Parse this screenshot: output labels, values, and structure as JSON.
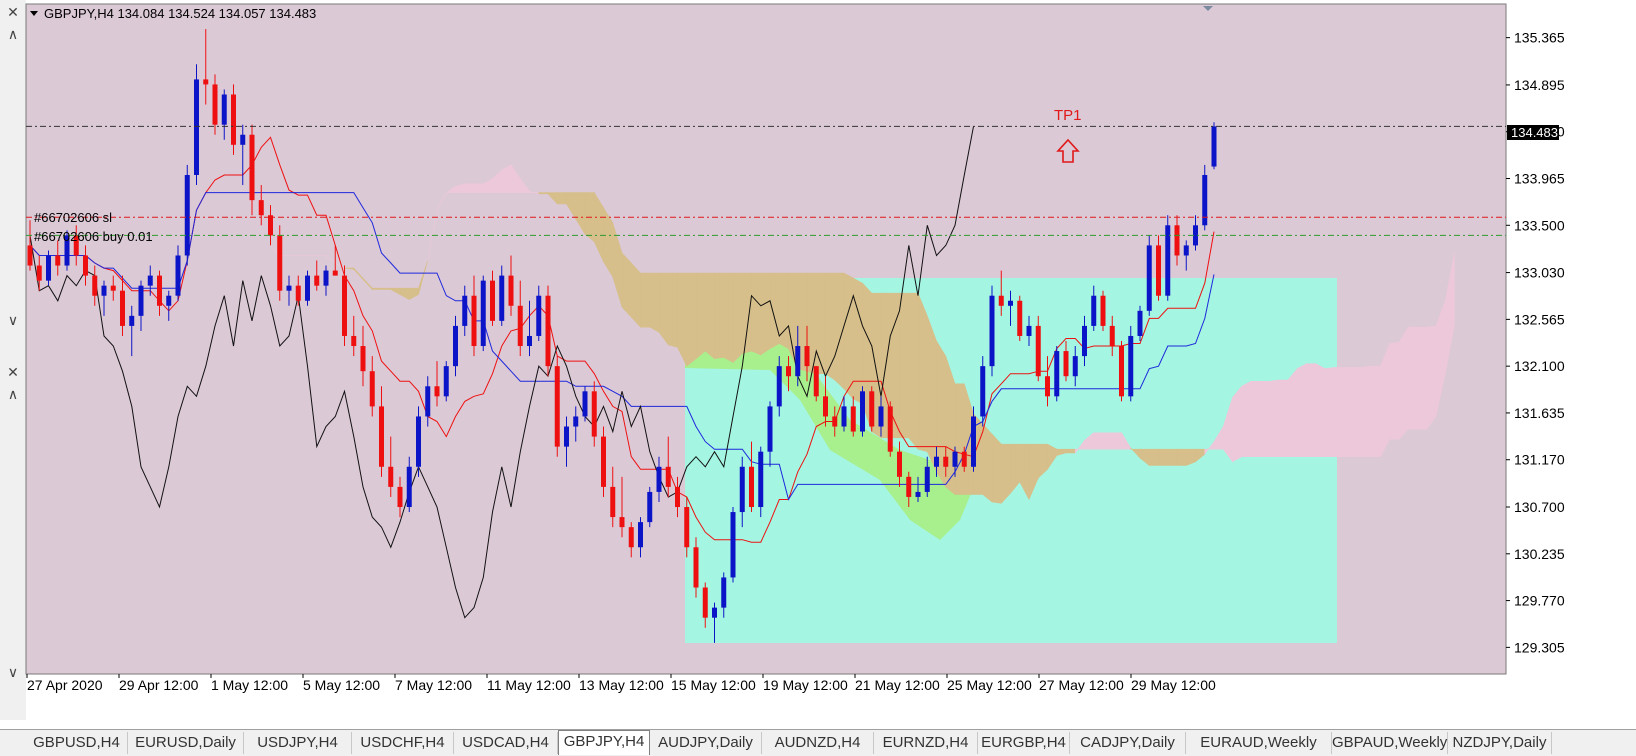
{
  "window": {
    "symbol_header": "GBPJPY,H4  134.084 134.524 134.057 134.483"
  },
  "colors": {
    "chart_bg": "#dcc9d6",
    "bull": "#0c14c8",
    "bear": "#ee1010",
    "tenkan": "#ee1010",
    "kijun": "#1e28dc",
    "chikou": "#111111",
    "kumo_bear": "#d6bf8a",
    "kumo_bull": "#ecc8da",
    "zone_cyan": "#a4f6e2",
    "zone_green": "#a8ee84"
  },
  "price_axis": {
    "ticks": [
      "135.365",
      "134.895",
      "134.430",
      "133.965",
      "133.500",
      "133.030",
      "132.565",
      "132.100",
      "131.635",
      "131.170",
      "130.700",
      "130.235",
      "129.770",
      "129.305"
    ],
    "current_price_label": "134.483"
  },
  "time_axis": {
    "labels": [
      "27 Apr 2020",
      "29 Apr 12:00",
      "1 May 12:00",
      "5 May 12:00",
      "7 May 12:00",
      "11 May 12:00",
      "13 May 12:00",
      "15 May 12:00",
      "19 May 12:00",
      "21 May 12:00",
      "25 May 12:00",
      "27 May 12:00",
      "29 May 12:00"
    ]
  },
  "annotations": {
    "tp_label": "TP1",
    "sl_label": "#66702606 sl",
    "buy_label": "#66702606 buy 0.01"
  },
  "tabs": [
    {
      "label": "GBPUSD,H4"
    },
    {
      "label": "EURUSD,Daily"
    },
    {
      "label": "USDJPY,H4"
    },
    {
      "label": "USDCHF,H4"
    },
    {
      "label": "USDCAD,H4"
    },
    {
      "label": "GBPJPY,H4"
    },
    {
      "label": "AUDJPY,Daily"
    },
    {
      "label": "AUDNZD,H4"
    },
    {
      "label": "EURNZD,H4"
    },
    {
      "label": "EURGBP,H4"
    },
    {
      "label": "CADJPY,Daily"
    },
    {
      "label": "EURAUD,Weekly"
    },
    {
      "label": "GBPAUD,Weekly"
    },
    {
      "label": "NZDJPY,Daily"
    }
  ],
  "chart_data": {
    "type": "candlestick",
    "title": "GBPJPY,H4  134.084 134.524 134.057 134.483",
    "ylim": [
      129.1,
      135.6
    ],
    "current_price": 134.483,
    "sl_price": 133.58,
    "buy_price": 133.4,
    "candles": [
      [
        133.3,
        133.55,
        133.05,
        133.1
      ],
      [
        133.1,
        133.2,
        132.85,
        132.95
      ],
      [
        132.95,
        133.25,
        132.9,
        133.2
      ],
      [
        133.2,
        133.35,
        133.0,
        133.1
      ],
      [
        133.1,
        133.45,
        133.05,
        133.4
      ],
      [
        133.4,
        133.5,
        133.1,
        133.2
      ],
      [
        133.2,
        133.3,
        132.9,
        133.0
      ],
      [
        133.0,
        133.1,
        132.7,
        132.8
      ],
      [
        132.8,
        132.95,
        132.6,
        132.9
      ],
      [
        132.9,
        133.0,
        132.75,
        132.85
      ],
      [
        132.85,
        133.0,
        132.4,
        132.5
      ],
      [
        132.5,
        132.7,
        132.2,
        132.6
      ],
      [
        132.6,
        132.95,
        132.45,
        132.9
      ],
      [
        132.9,
        133.1,
        132.8,
        133.0
      ],
      [
        133.0,
        133.05,
        132.6,
        132.7
      ],
      [
        132.7,
        132.85,
        132.55,
        132.8
      ],
      [
        132.8,
        133.3,
        132.75,
        133.2
      ],
      [
        133.2,
        134.1,
        133.1,
        134.0
      ],
      [
        134.0,
        135.1,
        133.9,
        134.95
      ],
      [
        134.95,
        135.45,
        134.7,
        134.9
      ],
      [
        134.9,
        135.0,
        134.4,
        134.5
      ],
      [
        134.5,
        134.85,
        134.35,
        134.8
      ],
      [
        134.8,
        134.9,
        134.2,
        134.3
      ],
      [
        134.3,
        134.5,
        133.9,
        134.4
      ],
      [
        134.4,
        134.5,
        133.6,
        133.75
      ],
      [
        133.75,
        133.9,
        133.5,
        133.6
      ],
      [
        133.6,
        133.7,
        133.3,
        133.4
      ],
      [
        133.4,
        133.5,
        132.75,
        132.85
      ],
      [
        132.85,
        133.0,
        132.7,
        132.9
      ],
      [
        132.9,
        133.0,
        132.7,
        132.75
      ],
      [
        132.75,
        133.05,
        132.7,
        133.0
      ],
      [
        133.0,
        133.15,
        132.85,
        132.9
      ],
      [
        132.9,
        133.1,
        132.8,
        133.05
      ],
      [
        133.05,
        133.3,
        133.0,
        133.0
      ],
      [
        133.0,
        133.1,
        132.3,
        132.4
      ],
      [
        132.4,
        132.6,
        132.2,
        132.3
      ],
      [
        132.3,
        132.5,
        131.9,
        132.05
      ],
      [
        132.05,
        132.2,
        131.6,
        131.7
      ],
      [
        131.7,
        131.9,
        131.0,
        131.1
      ],
      [
        131.1,
        131.4,
        130.8,
        130.9
      ],
      [
        130.9,
        131.0,
        130.6,
        130.7
      ],
      [
        130.7,
        131.2,
        130.65,
        131.1
      ],
      [
        131.1,
        131.7,
        131.0,
        131.6
      ],
      [
        131.6,
        132.0,
        131.5,
        131.9
      ],
      [
        131.9,
        132.15,
        131.7,
        131.8
      ],
      [
        131.8,
        132.15,
        131.75,
        132.1
      ],
      [
        132.1,
        132.6,
        132.0,
        132.5
      ],
      [
        132.5,
        132.9,
        132.4,
        132.8
      ],
      [
        132.8,
        133.0,
        132.2,
        132.3
      ],
      [
        132.3,
        133.0,
        132.25,
        132.95
      ],
      [
        132.95,
        133.05,
        132.5,
        132.55
      ],
      [
        132.55,
        133.1,
        132.5,
        133.0
      ],
      [
        133.0,
        133.2,
        132.6,
        132.7
      ],
      [
        132.7,
        132.95,
        132.2,
        132.3
      ],
      [
        132.3,
        132.75,
        132.2,
        132.4
      ],
      [
        132.4,
        132.9,
        132.35,
        132.8
      ],
      [
        132.8,
        132.9,
        132.0,
        132.1
      ],
      [
        132.1,
        132.2,
        131.2,
        131.3
      ],
      [
        131.3,
        131.6,
        131.1,
        131.5
      ],
      [
        131.5,
        131.7,
        131.35,
        131.6
      ],
      [
        131.6,
        131.9,
        131.55,
        131.85
      ],
      [
        131.85,
        131.95,
        131.3,
        131.4
      ],
      [
        131.4,
        131.5,
        130.8,
        130.9
      ],
      [
        130.9,
        131.1,
        130.5,
        130.6
      ],
      [
        130.6,
        131.0,
        130.4,
        130.5
      ],
      [
        130.5,
        130.55,
        130.2,
        130.3
      ],
      [
        130.3,
        130.6,
        130.2,
        130.55
      ],
      [
        130.55,
        130.9,
        130.5,
        130.85
      ],
      [
        130.85,
        131.2,
        130.75,
        131.1
      ],
      [
        131.1,
        131.4,
        130.8,
        130.9
      ],
      [
        130.9,
        131.0,
        130.6,
        130.7
      ],
      [
        130.7,
        130.8,
        130.2,
        130.3
      ],
      [
        130.3,
        130.4,
        129.8,
        129.9
      ],
      [
        129.9,
        129.95,
        129.5,
        129.6
      ],
      [
        129.6,
        129.75,
        129.35,
        129.7
      ],
      [
        129.7,
        130.05,
        129.6,
        130.0
      ],
      [
        130.0,
        130.7,
        129.95,
        130.65
      ],
      [
        130.65,
        131.2,
        130.5,
        131.1
      ],
      [
        131.1,
        131.35,
        130.65,
        130.7
      ],
      [
        130.7,
        131.3,
        130.6,
        131.25
      ],
      [
        131.25,
        131.75,
        131.1,
        131.7
      ],
      [
        131.7,
        132.2,
        131.6,
        132.1
      ],
      [
        132.1,
        132.2,
        131.85,
        132.0
      ],
      [
        132.0,
        132.5,
        131.9,
        132.3
      ],
      [
        132.3,
        132.5,
        131.95,
        132.1
      ],
      [
        132.1,
        132.1,
        131.75,
        131.8
      ],
      [
        131.8,
        132.0,
        131.5,
        131.6
      ],
      [
        131.6,
        131.7,
        131.4,
        131.5
      ],
      [
        131.5,
        131.8,
        131.45,
        131.7
      ],
      [
        131.7,
        131.8,
        131.4,
        131.45
      ],
      [
        131.45,
        131.9,
        131.4,
        131.85
      ],
      [
        131.85,
        131.9,
        131.45,
        131.5
      ],
      [
        131.5,
        131.8,
        131.4,
        131.7
      ],
      [
        131.7,
        131.75,
        131.2,
        131.25
      ],
      [
        131.25,
        131.35,
        130.9,
        131.0
      ],
      [
        131.0,
        131.05,
        130.7,
        130.8
      ],
      [
        130.8,
        131.0,
        130.75,
        130.85
      ],
      [
        130.85,
        131.2,
        130.8,
        131.1
      ],
      [
        131.1,
        131.3,
        131.0,
        131.2
      ],
      [
        131.2,
        131.3,
        131.0,
        131.1
      ],
      [
        131.1,
        131.3,
        131.0,
        131.25
      ],
      [
        131.25,
        131.3,
        131.05,
        131.1
      ],
      [
        131.1,
        131.7,
        131.05,
        131.6
      ],
      [
        131.6,
        132.2,
        131.5,
        132.1
      ],
      [
        132.1,
        132.9,
        132.0,
        132.8
      ],
      [
        132.8,
        133.05,
        132.6,
        132.7
      ],
      [
        132.7,
        132.85,
        132.5,
        132.75
      ],
      [
        132.75,
        132.8,
        132.35,
        132.4
      ],
      [
        132.4,
        132.6,
        132.3,
        132.5
      ],
      [
        132.5,
        132.6,
        131.95,
        132.0
      ],
      [
        132.0,
        132.2,
        131.7,
        131.8
      ],
      [
        131.8,
        132.3,
        131.75,
        132.25
      ],
      [
        132.25,
        132.35,
        131.95,
        132.0
      ],
      [
        132.0,
        132.3,
        131.9,
        132.2
      ],
      [
        132.2,
        132.6,
        132.1,
        132.5
      ],
      [
        132.5,
        132.9,
        132.45,
        132.8
      ],
      [
        132.8,
        132.85,
        132.45,
        132.5
      ],
      [
        132.5,
        132.6,
        132.2,
        132.3
      ],
      [
        132.3,
        132.35,
        131.75,
        131.8
      ],
      [
        131.8,
        132.5,
        131.75,
        132.4
      ],
      [
        132.4,
        132.7,
        132.35,
        132.65
      ],
      [
        132.65,
        133.4,
        132.6,
        133.3
      ],
      [
        133.3,
        133.4,
        132.75,
        132.8
      ],
      [
        132.8,
        133.6,
        132.75,
        133.5
      ],
      [
        133.5,
        133.6,
        133.1,
        133.2
      ],
      [
        133.2,
        133.35,
        133.05,
        133.3
      ],
      [
        133.3,
        133.6,
        133.25,
        133.5
      ],
      [
        133.5,
        134.1,
        133.45,
        134.0
      ],
      [
        134.084,
        134.524,
        134.057,
        134.483
      ]
    ]
  }
}
